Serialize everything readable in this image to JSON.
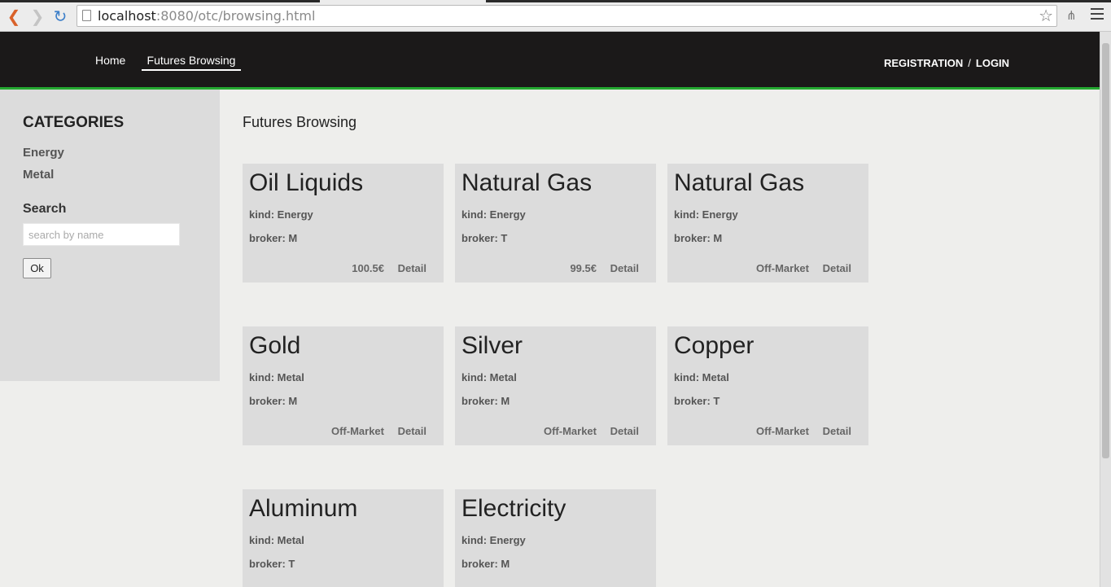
{
  "browser": {
    "url_host": "localhost",
    "url_rest": ":8080/otc/browsing.html"
  },
  "header": {
    "nav": [
      {
        "label": "Home"
      },
      {
        "label": "Futures Browsing"
      }
    ],
    "registration_label": "REGISTRATION",
    "separator": "/",
    "login_label": "LOGIN"
  },
  "sidebar": {
    "categories_title": "CATEGORIES",
    "categories": [
      {
        "label": "Energy"
      },
      {
        "label": "Metal"
      }
    ],
    "search_title": "Search",
    "search_placeholder": "search by name",
    "search_value": "",
    "ok_label": "Ok"
  },
  "main": {
    "title": "Futures Browsing",
    "cards": [
      {
        "name": "Oil Liquids",
        "kind": "kind: Energy",
        "broker": "broker: M",
        "price": "100.5€",
        "detail": "Detail"
      },
      {
        "name": "Natural Gas",
        "kind": "kind: Energy",
        "broker": "broker: T",
        "price": "99.5€",
        "detail": "Detail"
      },
      {
        "name": "Natural Gas",
        "kind": "kind: Energy",
        "broker": "broker: M",
        "price": "Off-Market",
        "detail": "Detail"
      },
      {
        "name": "Gold",
        "kind": "kind: Metal",
        "broker": "broker: M",
        "price": "Off-Market",
        "detail": "Detail"
      },
      {
        "name": "Silver",
        "kind": "kind: Metal",
        "broker": "broker: M",
        "price": "Off-Market",
        "detail": "Detail"
      },
      {
        "name": "Copper",
        "kind": "kind: Metal",
        "broker": "broker: T",
        "price": "Off-Market",
        "detail": "Detail"
      },
      {
        "name": "Aluminum",
        "kind": "kind: Metal",
        "broker": "broker: T"
      },
      {
        "name": "Electricity",
        "kind": "kind: Energy",
        "broker": "broker: M"
      }
    ]
  },
  "colors": {
    "header_bg": "#1b1919",
    "accent_green": "#24a830",
    "page_bg": "#eeeeec",
    "card_bg": "#dcdcdc"
  }
}
